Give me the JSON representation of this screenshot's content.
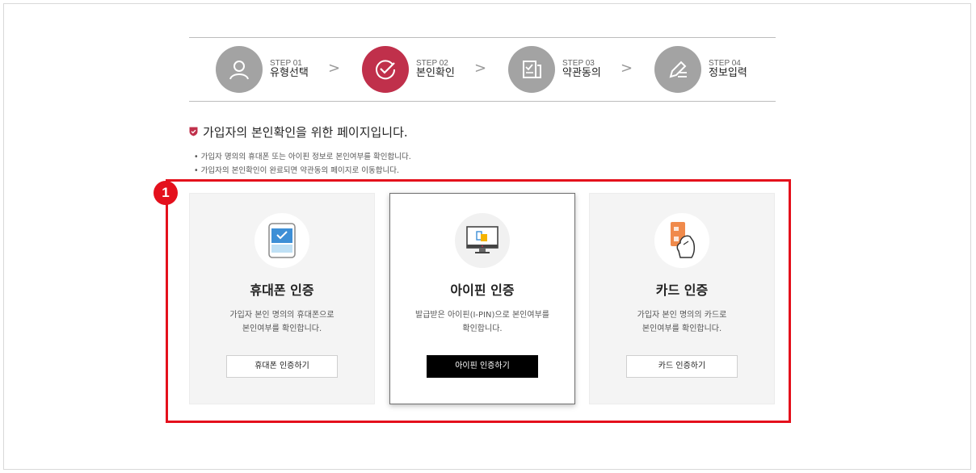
{
  "steps": [
    {
      "no": "STEP 01",
      "name": "유형선택",
      "icon": "user-icon",
      "active": false
    },
    {
      "no": "STEP 02",
      "name": "본인확인",
      "icon": "check-circle-icon",
      "active": true
    },
    {
      "no": "STEP 03",
      "name": "약관동의",
      "icon": "terms-document-icon",
      "active": false
    },
    {
      "no": "STEP 04",
      "name": "정보입력",
      "icon": "pen-write-icon",
      "active": false
    }
  ],
  "step_separator": ">",
  "page_title": "가입자의 본인확인을 위한 페이지입니다.",
  "bullets": [
    "가입자 명의의 휴대폰 또는 아이핀 정보로 본인여부를 확인합니다.",
    "가입자의 본인확인이 완료되면 약관동의 페이지로 이동합니다."
  ],
  "annotation_badge": "1",
  "cards": [
    {
      "title": "휴대폰 인증",
      "desc": "가입자 본인 명의의 휴대폰으로\n본인여부를 확인합니다.",
      "button": "휴대폰 인증하기",
      "icon": "mobile-phone-icon"
    },
    {
      "title": "아이핀 인증",
      "desc": "발급받은 아이핀(I-PIN)으로 본인여부를\n확인합니다.",
      "button": "아이핀 인증하기",
      "icon": "monitor-ipin-icon"
    },
    {
      "title": "카드 인증",
      "desc": "가입자 본인 명의의 카드로\n본인여부를 확인합니다.",
      "button": "카드 인증하기",
      "icon": "card-hand-icon"
    }
  ],
  "colors": {
    "accent": "#c0304b",
    "highlight": "#e4101c",
    "step_inactive": "#a3a3a3"
  }
}
